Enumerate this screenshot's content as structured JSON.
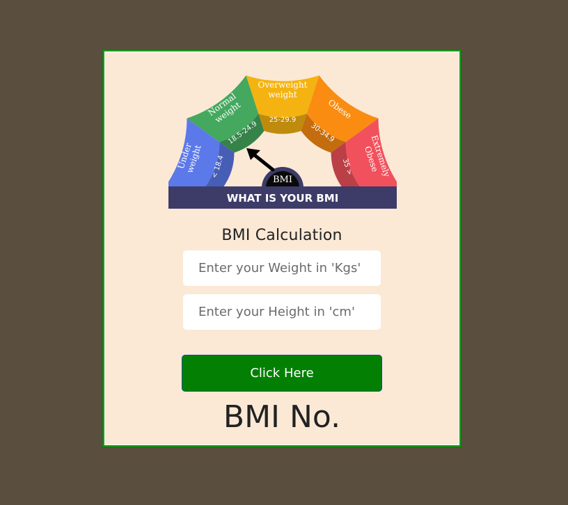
{
  "gauge": {
    "banner_text": "WHAT IS YOUR BMI",
    "center_label": "BMI",
    "segments": [
      {
        "name_line1": "Under",
        "name_line2": "weight",
        "range": "< 18.4",
        "color": "#5c79ea"
      },
      {
        "name_line1": "Normal",
        "name_line2": "weight",
        "range": "18.5-24.9",
        "color": "#44a85e"
      },
      {
        "name_line1": "Overweight",
        "name_line2": "weight",
        "range": "25-29.9",
        "color": "#f4b311"
      },
      {
        "name_line1": "Obese",
        "name_line2": "",
        "range": "30-34.9",
        "color": "#fa8c12"
      },
      {
        "name_line1": "Extremely",
        "name_line2": "Obese",
        "range": "35 >",
        "color": "#f0515c"
      }
    ],
    "banner_color": "#3d3b67"
  },
  "form": {
    "title": "BMI Calculation",
    "weight_placeholder": "Enter your Weight in 'Kgs'",
    "height_placeholder": "Enter your Height in 'cm'",
    "button_label": "Click Here"
  },
  "result": {
    "text": "BMI No."
  },
  "colors": {
    "page_bg": "#5a4e3e",
    "card_bg": "#fbe9d6",
    "card_border": "#1e9a1e",
    "button_bg": "#038003"
  }
}
